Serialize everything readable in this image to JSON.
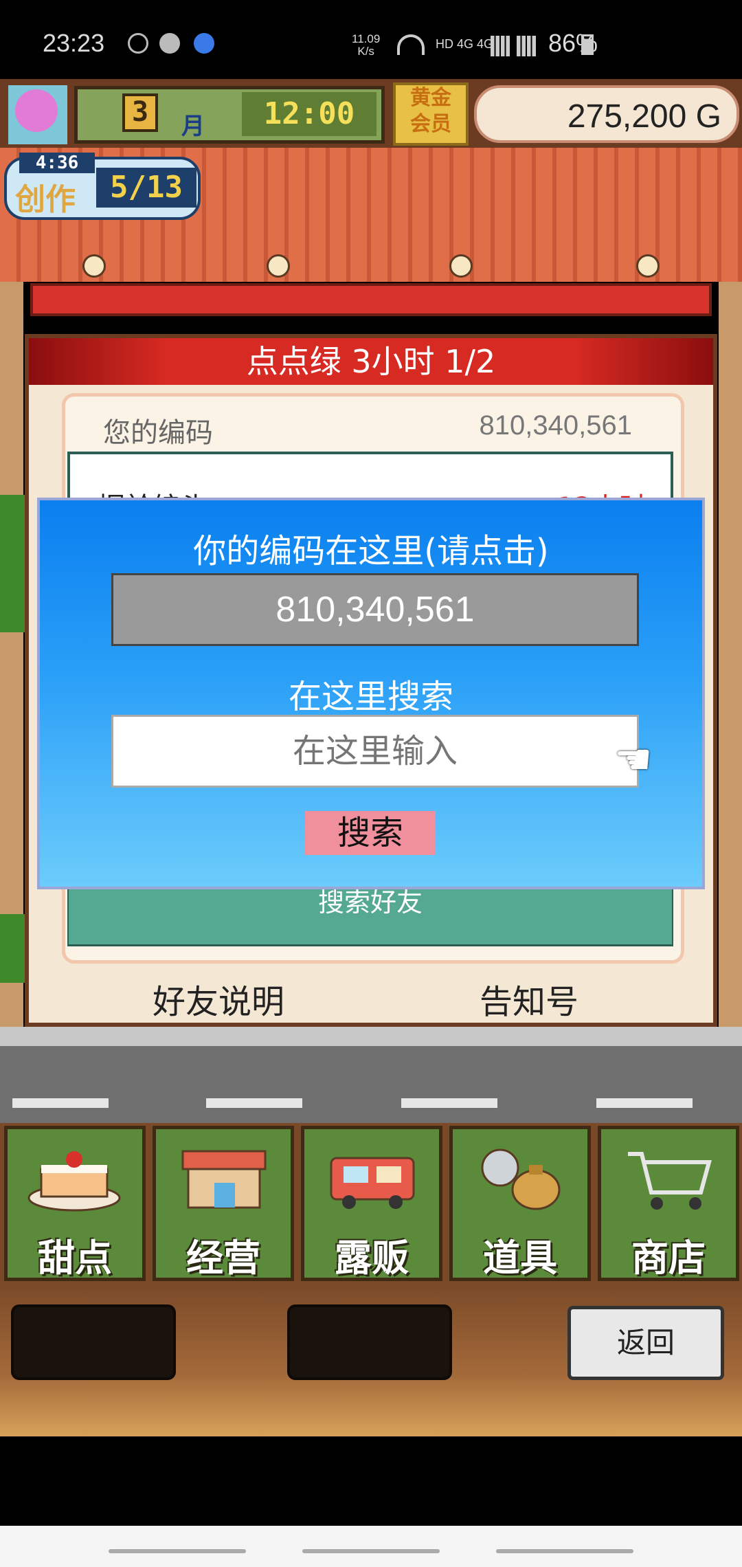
{
  "status_bar": {
    "time": "23:23",
    "net_speed_top": "11.09",
    "net_speed_bottom": "K/s",
    "net_types": "HD 4G 4G",
    "battery": "86%"
  },
  "hud": {
    "month_number": "3",
    "month_unit": "月",
    "clock": "12:00",
    "gold_member_line1": "黄金",
    "gold_member_line2": "会员",
    "money": "275,200 G"
  },
  "create_badge": {
    "timer": "4:36",
    "label": "创作",
    "count": "5/13"
  },
  "panel": {
    "title": "点点绿  3小时 1/2",
    "your_code_label": "您的编码",
    "your_code_value": "810,340,561",
    "partial_row_left": "据於编头",
    "partial_row_right": "12小时",
    "search_friends_label": "搜索好友",
    "friend_help": "好友说明",
    "notice_no": "告知号"
  },
  "dialog": {
    "title": "你的编码在这里(请点击)",
    "code": "810,340,561",
    "search_label": "在这里搜索",
    "search_placeholder": "在这里输入",
    "search_button": "搜索"
  },
  "menu": {
    "items": [
      {
        "label": "甜点",
        "icon": "cake-icon"
      },
      {
        "label": "经营",
        "icon": "shop-building-icon"
      },
      {
        "label": "露贩",
        "icon": "food-truck-icon"
      },
      {
        "label": "道具",
        "icon": "items-bag-icon"
      },
      {
        "label": "商店",
        "icon": "shopping-cart-icon"
      }
    ]
  },
  "back_button": "返回",
  "colors": {
    "dialog_top": "#0a7fef",
    "dialog_bottom": "#6cccfb",
    "search_button": "#f0909c",
    "panel_header": "#d62a22",
    "friend_button": "#55a891"
  }
}
